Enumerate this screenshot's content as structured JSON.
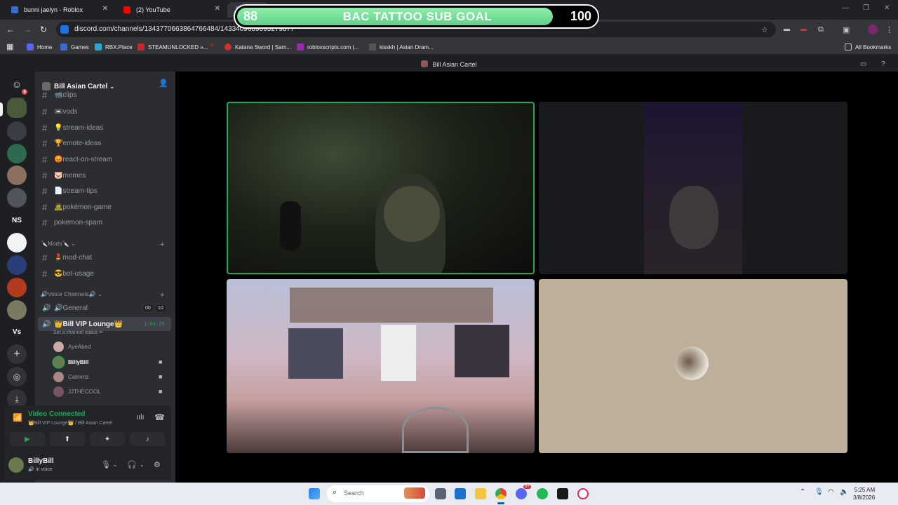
{
  "browser": {
    "tabs": [
      {
        "title": "bunni jaelyn - Roblox"
      },
      {
        "title": "(2) YouTube"
      },
      {
        "title": ""
      }
    ],
    "url": "discord.com/channels/1343770663864766484/1433409689095279877",
    "bookmarks": [
      "Home",
      "Games",
      "RBX.Place",
      "STEAMUNLOCKED »...",
      "Katana Sword | Sam...",
      "robloxscripts.com |...",
      "kisskh | Asian Dram..."
    ],
    "all_bookmarks": "All Bookmarks"
  },
  "overlay": {
    "current": "88",
    "title": "BAC TATTOO SUB GOAL",
    "target": "100",
    "progress_fraction": 0.88
  },
  "discord": {
    "window_title": "Bill Asian Cartel",
    "server_name": "Bill Asian Cartel",
    "guild_badge": "3",
    "guild_initials": [
      "NS",
      "Vs"
    ],
    "channels": [
      {
        "name": "📹clips"
      },
      {
        "name": "📼vods"
      },
      {
        "name": "💡stream-ideas"
      },
      {
        "name": "🏆emote-ideas"
      },
      {
        "name": "😡react-on-stream"
      },
      {
        "name": "🐷memes"
      },
      {
        "name": "📄stream-tips"
      },
      {
        "name": "🧟pokémon-game"
      },
      {
        "name": "pokemon-spam"
      }
    ],
    "mods_category": "🔪Mods🔪",
    "mod_channels": [
      {
        "name": "💄mod-chat"
      },
      {
        "name": "😎bot-usage"
      }
    ],
    "voice_category": "🔊Voice Channels🔊",
    "voice_general": "🔊General",
    "voice_general_counts": [
      "00",
      "10"
    ],
    "vip_lounge": "👑Bill VIP Lounge👑",
    "vip_timer": "1:04:25",
    "vip_status": "Set a channel status ✏",
    "voice_users": [
      "AyeAbed",
      "BillyBill",
      "Calmmz",
      "JJTHECOOL"
    ],
    "video_connected": "Video Connected",
    "video_sub": "👑Bill VIP Lounge👑 / Bill Asian Cartel",
    "me": {
      "name": "BillyBill",
      "status": "In voice"
    }
  },
  "taskbar": {
    "search": "Search",
    "time": "5:25 AM",
    "date": "3/8/2026",
    "discord_badge": "9+"
  },
  "colors": {
    "accent_green": "#23a55a",
    "goal_fill": "#6fe096"
  }
}
